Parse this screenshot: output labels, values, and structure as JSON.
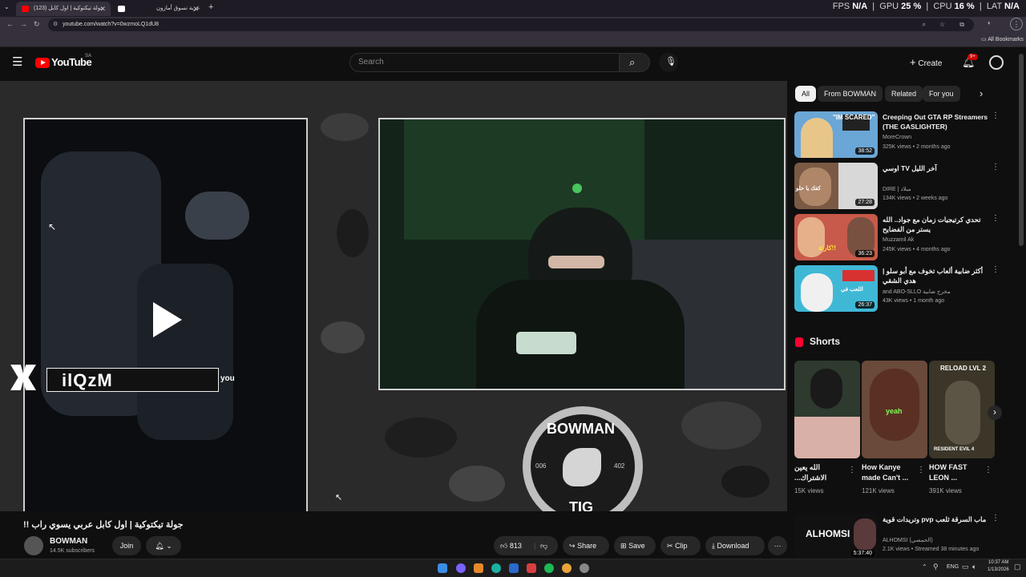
{
  "browser": {
    "tabs": [
      {
        "title": "(123) جولة تيكتوكية | اول كابل",
        "active": true
      },
      {
        "title": "عربة تسوق أمازون",
        "active": false
      }
    ],
    "new_tab_icon": "plus-icon",
    "url": "youtube.com/watch?v=0wzmoLQ1dU8",
    "all_bookmarks": "All Bookmarks"
  },
  "overlay_stats": {
    "fps_label": "FPS",
    "fps_value": "N/A",
    "gpu_label": "GPU",
    "gpu_value": "25 %",
    "cpu_label": "CPU",
    "cpu_value": "16 %",
    "lat_label": "LAT",
    "lat_value": "N/A"
  },
  "masthead": {
    "logo": "YouTube",
    "country": "SA",
    "search_placeholder": "Search",
    "create_label": "Create",
    "notification_badge": "9+"
  },
  "player": {
    "caption_text": "you",
    "overlay_name": "ilQzM",
    "logo_top": "BOWMAN",
    "logo_bottom": "TIG",
    "logo_left_num": "006",
    "logo_right_num": "402"
  },
  "video": {
    "title": "جولة تيكتوكية | اول كابل عربي يسوي راب !!",
    "channel": "BOWMAN",
    "subscribers": "14.5K subscribers",
    "join_label": "Join",
    "likes": "813",
    "share_label": "Share",
    "save_label": "Save",
    "clip_label": "Clip",
    "download_label": "Download"
  },
  "chips": [
    "All",
    "From BOWMAN",
    "Related",
    "For you"
  ],
  "recommendations": [
    {
      "title": "Creeping Out GTA RP Streamers (THE GASLIGHTER)",
      "channel": "MoreCrown",
      "meta": "325K views • 2 months ago",
      "duration": "38:52",
      "thumb_text": "\"IM SCARED\""
    },
    {
      "title": "اوسي TV آخر الليل",
      "channel": "DIRE | ميلاد",
      "meta": "134K views • 2 weeks ago",
      "duration": "27:28",
      "thumb_text": "كفك يا حلو"
    },
    {
      "title": "تحدي كرتيجيات زمان مع جواد.. الله يستر من الفضايح",
      "channel": "Muzzamil Ak",
      "meta": "245K views • 4 months ago",
      "duration": "36:23",
      "thumb_text": "كارثة!!"
    },
    {
      "title": "أكثر ضابية ألعاب تخوف مع أبو سلو | هدي الشقي",
      "channel": "and ABO-SLLO مخرج ضابية",
      "meta": "43K views • 1 month ago",
      "duration": "26:37",
      "thumb_text": "اللعب في"
    }
  ],
  "shorts": {
    "header": "Shorts",
    "items": [
      {
        "title": "الله يعين الاشتراك...",
        "views": "15K views"
      },
      {
        "title": "How Kanye made Can't ...",
        "views": "121K views",
        "thumb_text": "yeah"
      },
      {
        "title": "HOW FAST LEON ...",
        "views": "391K views",
        "thumb_text": "RELOAD LVL 2",
        "thumb_text2": "RESIDENT EVIL 4"
      }
    ]
  },
  "bottom_rec": {
    "title": "ماب السرقة ثلعب pvp وتريدات قوية",
    "channel": "ALHOMSI (الحمصي)",
    "meta": "2.1K views • Streamed 38 minutes ago",
    "duration": "5:37:40",
    "thumb_text": "ALHOMSI"
  },
  "taskbar": {
    "lang": "ENG",
    "time": "10:37 AM",
    "date": "1/13/2026"
  }
}
